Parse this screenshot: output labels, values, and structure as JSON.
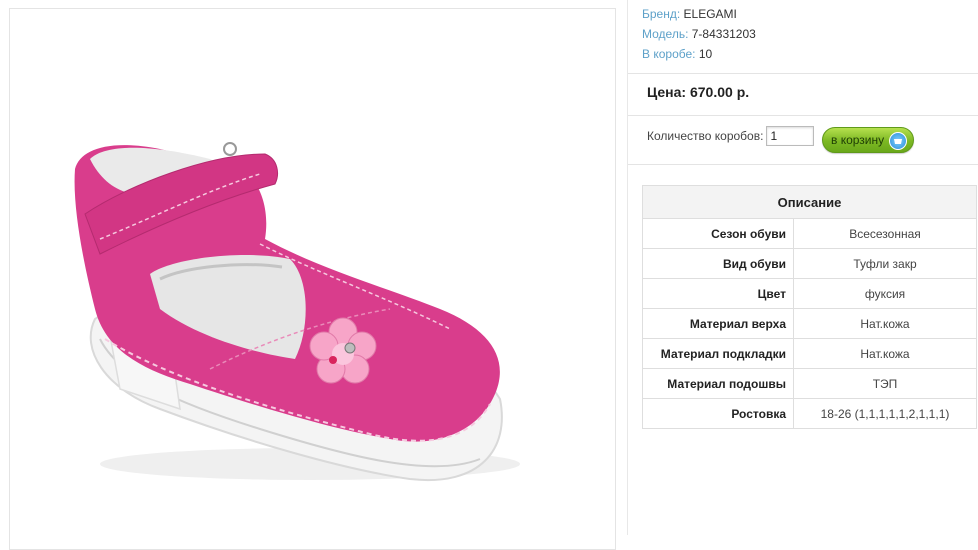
{
  "product": {
    "image_alt": "pink children's shoe with flower",
    "meta": [
      {
        "label": "Бренд:",
        "value": "ELEGAMI"
      },
      {
        "label": "Модель:",
        "value": "7-84331203"
      },
      {
        "label": "В коробе:",
        "value": "10"
      }
    ],
    "price": "Цена: 670.00 р.",
    "quantity_label": "Количество коробов:",
    "quantity_value": "1",
    "cart_button": "в корзину"
  },
  "description": {
    "title": "Описание",
    "rows": [
      {
        "key": "Сезон обуви",
        "value": "Всесезонная"
      },
      {
        "key": "Вид обуви",
        "value": "Туфли закр"
      },
      {
        "key": "Цвет",
        "value": "фуксия"
      },
      {
        "key": "Материал верха",
        "value": "Нат.кожа"
      },
      {
        "key": "Материал подкладки",
        "value": "Нат.кожа"
      },
      {
        "key": "Материал подошвы",
        "value": "ТЭП"
      },
      {
        "key": "Ростовка",
        "value": "18-26 (1,1,1,1,1,2,1,1,1)"
      }
    ]
  },
  "colors": {
    "label_blue": "#5ea1c9",
    "shoe_pink": "#d93d8c",
    "button_green": "#7cb823"
  }
}
